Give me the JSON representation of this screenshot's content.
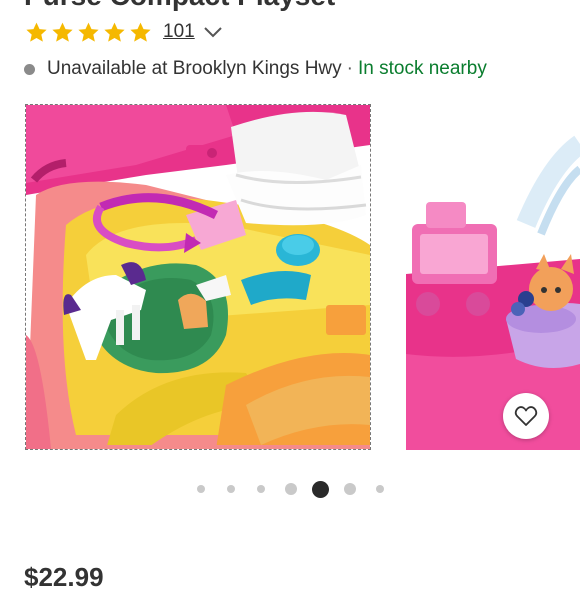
{
  "product": {
    "title": "Purse Compact Playset",
    "rating": {
      "value": 5,
      "max": 5,
      "review_count": "101"
    },
    "availability": {
      "store_status": "Unavailable at Brooklyn Kings Hwy",
      "separator": "·",
      "nearby_status": "In stock nearby"
    },
    "price": "$22.99"
  },
  "gallery": {
    "total_images": 7,
    "active_index": 4
  },
  "colors": {
    "star": "#f5b800",
    "in_stock": "#0a7d2e",
    "unavailable_dot": "#8a8a8a",
    "active_dot": "#2a2a2a",
    "inactive_dot": "#c9c9c9"
  },
  "icons": {
    "rating_star": "star-icon",
    "expand": "chevron-down-icon",
    "favorite": "heart-outline-icon"
  }
}
